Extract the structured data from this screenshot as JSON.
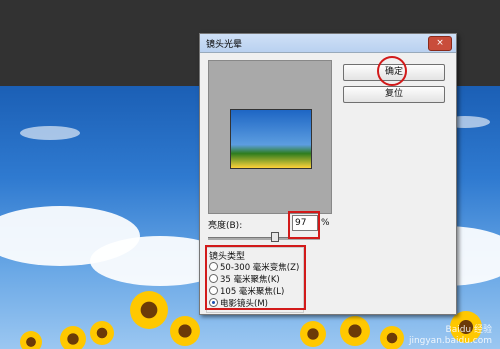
{
  "dialog": {
    "title": "镜头光晕",
    "close_glyph": "×",
    "ok_label": "确定",
    "reset_label": "复位",
    "brightness_label": "亮度(B):",
    "brightness_value": "97",
    "brightness_unit": "%",
    "brightness_slider_fraction": 0.66,
    "lens_group_title": "镜头类型",
    "lens_options": [
      {
        "label": "50-300 毫米变焦(Z)",
        "selected": false
      },
      {
        "label": "35 毫米聚焦(K)",
        "selected": false
      },
      {
        "label": "105 毫米聚焦(L)",
        "selected": false
      },
      {
        "label": "电影镜头(M)",
        "selected": true
      }
    ]
  },
  "watermark": {
    "line1": "Baidu 经验",
    "line2": "jingyan.baidu.com"
  },
  "colors": {
    "highlight": "#d21a1a",
    "titlebar": "#b9d1f0"
  }
}
